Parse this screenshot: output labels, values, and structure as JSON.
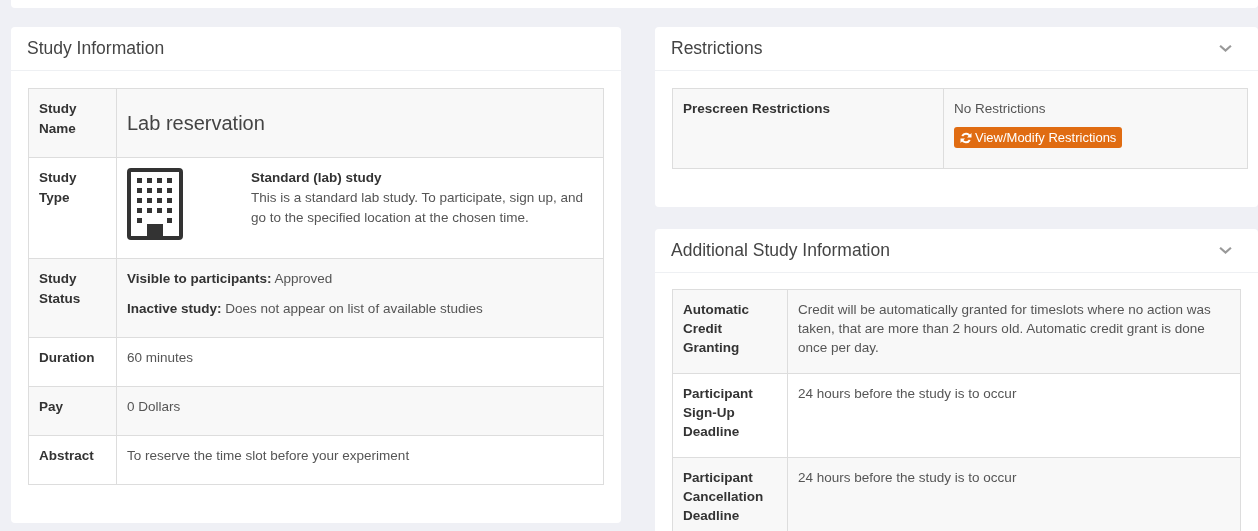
{
  "study_information": {
    "title": "Study Information",
    "rows": [
      {
        "kind": "name",
        "label": "Study Name",
        "value": "Lab reservation"
      },
      {
        "kind": "type",
        "label": "Study Type",
        "type_title": "Standard (lab) study",
        "type_description": "This is a standard lab study. To participate, sign up, and go to the specified location at the chosen time."
      },
      {
        "kind": "status",
        "label": "Study Status",
        "lines": [
          "**Visible to participants:** Approved",
          "**Inactive study:** Does not appear on list of available studies"
        ]
      },
      {
        "kind": "text",
        "label": "Duration",
        "value": "60 minutes"
      },
      {
        "kind": "text",
        "label": "Pay",
        "value": "0 Dollars"
      },
      {
        "kind": "text",
        "label": "Abstract",
        "value": "To reserve the time slot before your experiment"
      }
    ]
  },
  "restrictions": {
    "title": "Restrictions",
    "rows": [
      {
        "label": "Prescreen Restrictions",
        "value": "No Restrictions",
        "button": "View/Modify Restrictions"
      }
    ]
  },
  "additional_study_information": {
    "title": "Additional Study Information",
    "rows": [
      {
        "label": "Automatic Credit Granting",
        "value": "Credit will be automatically granted for timeslots where no action was taken, that are more than 2 hours old. Automatic credit grant is done once per day."
      },
      {
        "label": "Participant Sign-Up Deadline",
        "value": "24 hours before the study is to occur"
      },
      {
        "label": "Participant Cancellation Deadline",
        "value": "24 hours before the study is to occur"
      }
    ]
  }
}
